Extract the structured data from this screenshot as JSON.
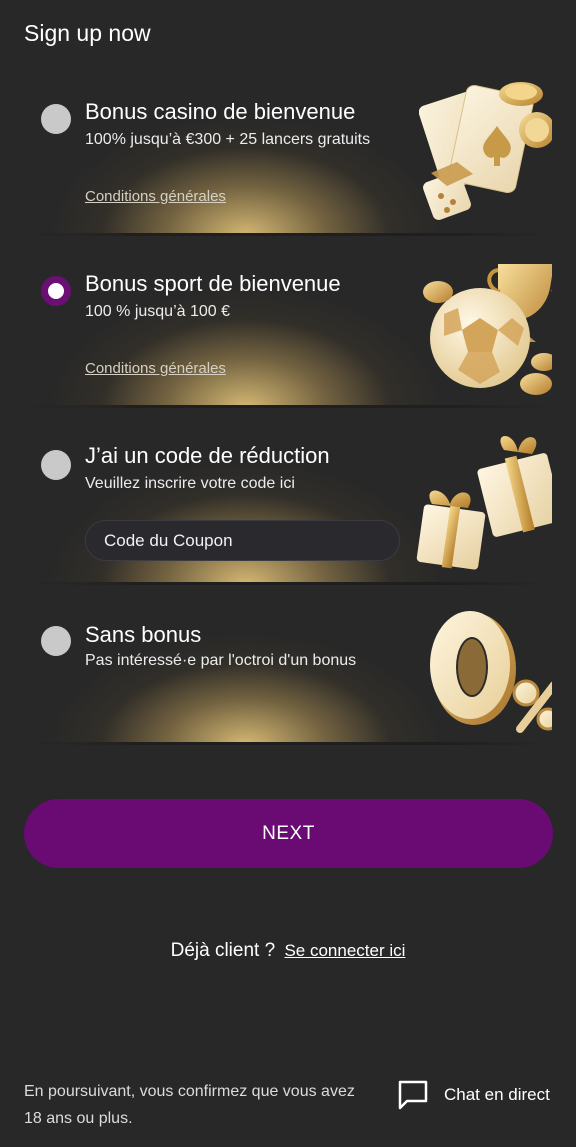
{
  "header": {
    "title": "Sign up now"
  },
  "options": [
    {
      "title": "Bonus casino de bienvenue",
      "subtitle": "100% jusqu’à €300 + 25 lancers gratuits",
      "link": "Conditions générales",
      "selected": false,
      "icon": "cards-dice-chips-icon"
    },
    {
      "title": "Bonus sport de bienvenue",
      "subtitle": "100 % jusqu’à 100 €",
      "link": "Conditions générales",
      "selected": true,
      "icon": "soccer-ball-trophy-icon"
    },
    {
      "title": "J’ai un code de réduction",
      "subtitle": "Veuillez inscrire votre code ici",
      "input_placeholder": "Code du Coupon",
      "input_value": "",
      "selected": false,
      "icon": "gift-boxes-icon"
    },
    {
      "title": "Sans bonus",
      "subtitle": "Pas intéressé·e par l'octroi d'un bonus",
      "selected": false,
      "icon": "zero-percent-icon"
    }
  ],
  "next_button": {
    "label": "NEXT"
  },
  "login": {
    "question": "Déjà client ?",
    "link": "Se connecter ici"
  },
  "footer": {
    "disclaimer": "En poursuivant, vous confirmez que vous avez 18 ans ou plus.",
    "chat_label": "Chat en direct",
    "chat_icon": "chat-bubble-icon"
  },
  "colors": {
    "background": "#282828",
    "accent_purple": "#690b73",
    "gold": "#e3c479",
    "radio_unselected": "#c9c9c9"
  }
}
